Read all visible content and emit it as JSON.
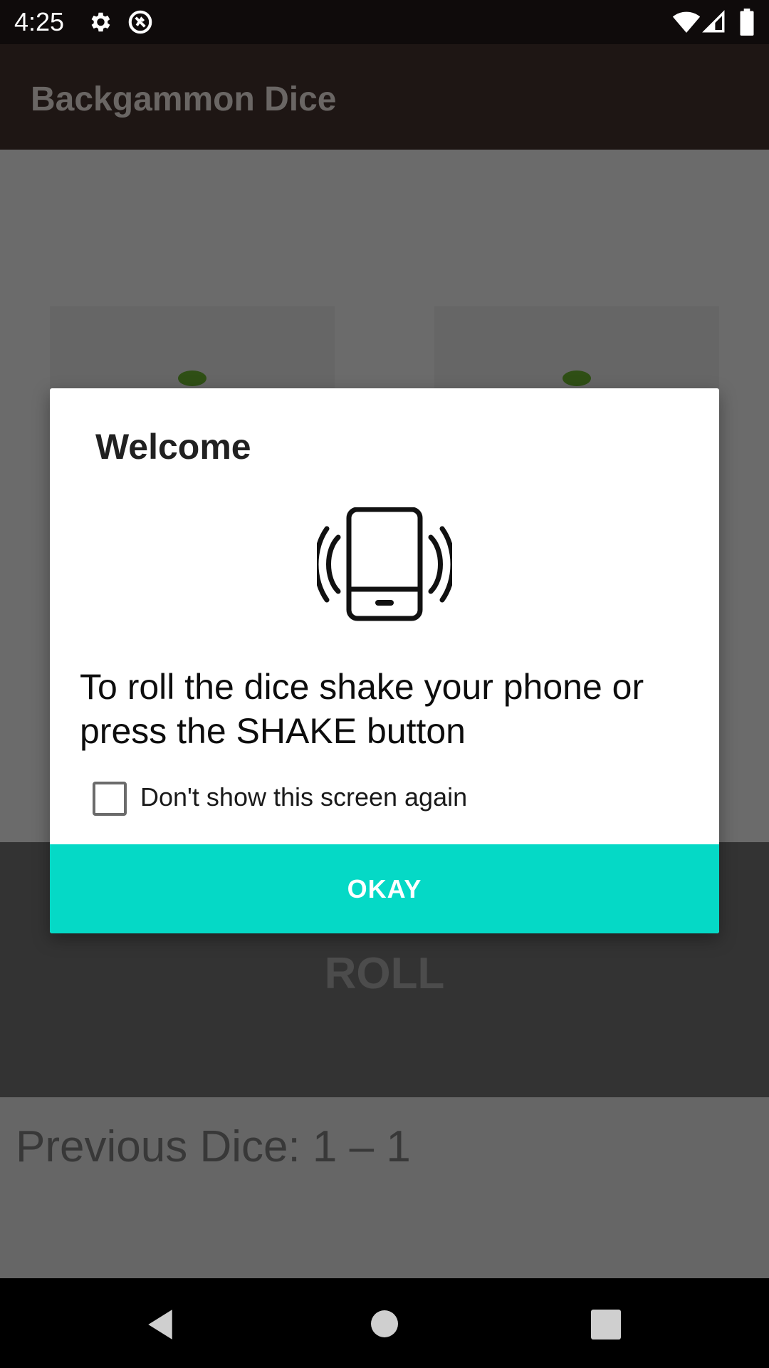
{
  "status_bar": {
    "time": "4:25",
    "icons": [
      "gear-icon",
      "data-saver-icon",
      "wifi-icon",
      "signal-icon",
      "battery-icon"
    ]
  },
  "app_bar": {
    "title": "Backgammon Dice"
  },
  "dice": {
    "pip_color": "#2f4f15"
  },
  "roll_panel": {
    "label": "ROLL"
  },
  "previous": {
    "text": "Previous Dice: 1 – 1"
  },
  "dialog": {
    "title": "Welcome",
    "icon": "phone-shake-icon",
    "message": "To roll the dice shake your phone or press the SHAKE button",
    "checkbox_label": "Don't show this screen again",
    "checkbox_checked": false,
    "okay_label": "OKAY",
    "okay_color": "#05d9c6"
  },
  "nav_bar": {
    "icons": [
      "back-icon",
      "home-icon",
      "recents-icon"
    ]
  }
}
